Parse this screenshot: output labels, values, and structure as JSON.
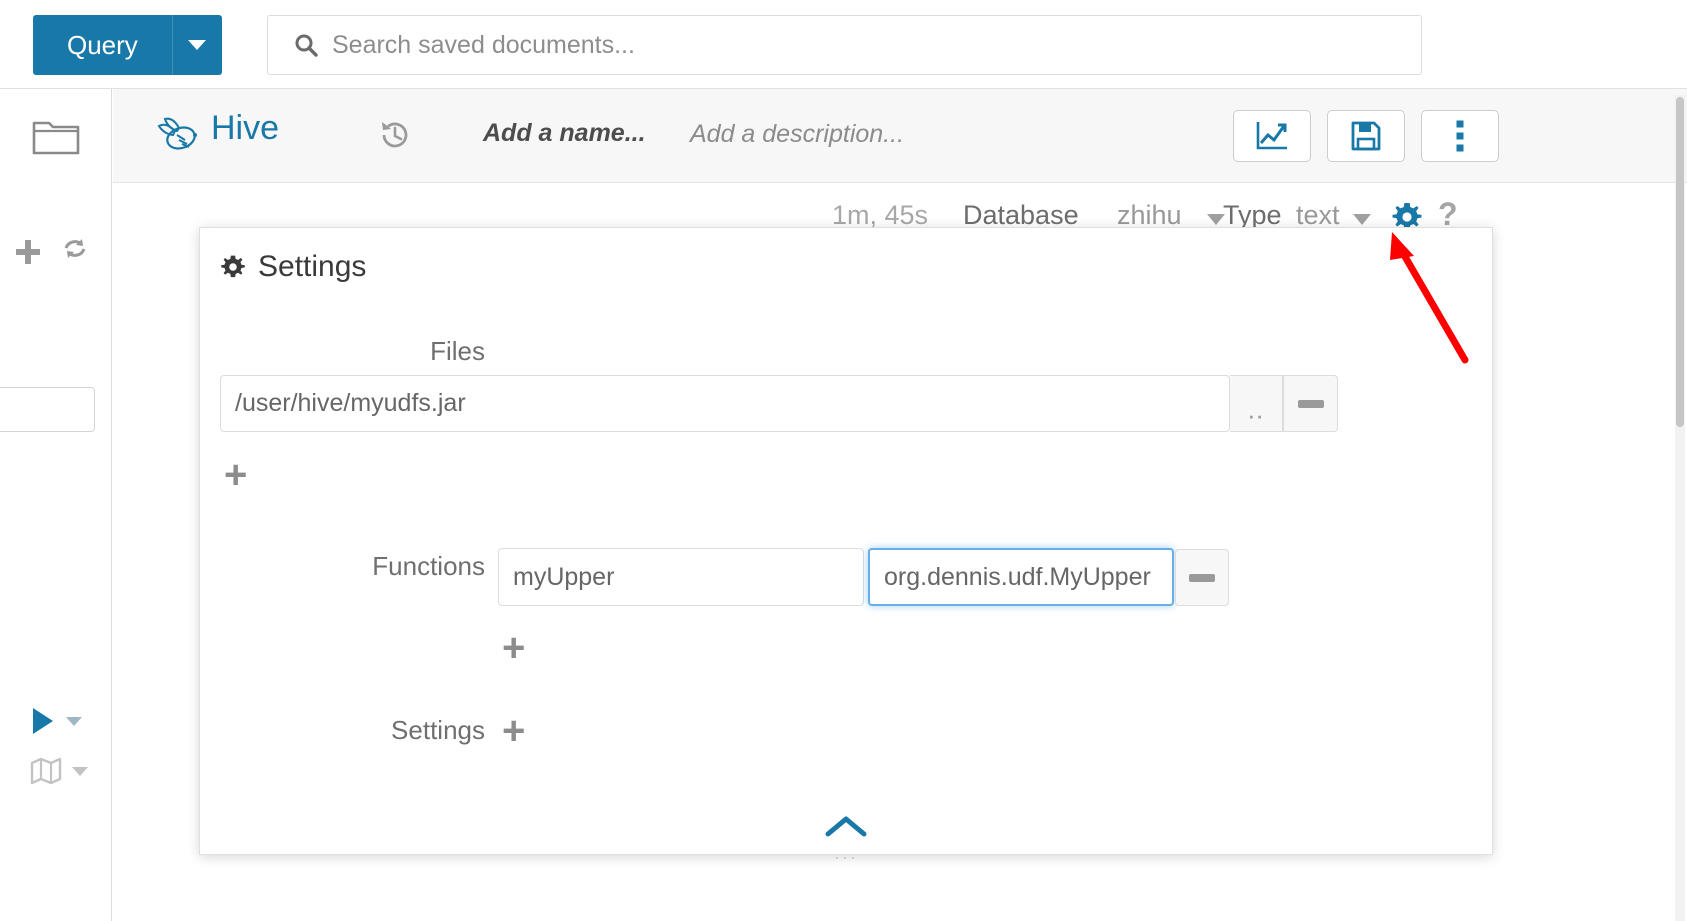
{
  "topbar": {
    "query_button_label": "Query",
    "query_dropdown_icon": "chevron-down-icon",
    "search_icon": "search-icon",
    "search_placeholder": "Search saved documents...",
    "search_value": ""
  },
  "left_rail": {
    "folder_icon": "folder-icon",
    "assist_paren": ")",
    "add_icon": "plus-icon",
    "refresh_icon": "refresh-icon",
    "run_icon": "play-icon",
    "run_caret_icon": "chevron-down-icon",
    "map_icon": "map-icon",
    "map_caret_icon": "chevron-down-icon"
  },
  "editor_header": {
    "logo_icon": "hive-bee-icon",
    "title": "Hive",
    "history_icon": "history-revert-icon",
    "name_placeholder": "Add a name...",
    "description_placeholder": "Add a description...",
    "buttons": [
      {
        "name": "chart-button",
        "icon": "chart-line-icon"
      },
      {
        "name": "save-button",
        "icon": "floppy-save-icon"
      },
      {
        "name": "more-options-button",
        "icon": "vertical-dots-icon"
      }
    ]
  },
  "sub_toolbar": {
    "elapsed": "1m, 45s",
    "database_label": "Database",
    "database_value": "zhihu",
    "type_label": "Type",
    "type_value": "text",
    "settings_icon": "gear-icon",
    "help_icon": "question-mark-icon"
  },
  "settings_panel": {
    "title": "Settings",
    "title_icon": "gear-icon",
    "files": {
      "label": "Files",
      "value": "/user/hive/myudfs.jar",
      "placeholder": "",
      "browse_label": "..",
      "remove_icon": "minus-icon",
      "add_icon": "plus-icon"
    },
    "functions": {
      "label": "Functions",
      "name_value": "myUpper",
      "name_placeholder": "",
      "class_value": "org.dennis.udf.MyUpper",
      "class_placeholder": "",
      "remove_icon": "minus-icon",
      "add_icon": "plus-icon"
    },
    "settings": {
      "label": "Settings",
      "add_icon": "plus-icon"
    },
    "collapse_icon": "chevron-up-icon",
    "resize_grip": "···"
  },
  "annotation": {
    "arrow_color": "#ff0000",
    "arrow_target": "settings-gear-icon"
  },
  "colors": {
    "brand_blue": "#1878a8",
    "focus_blue": "#66afe9",
    "panel_bg": "#ffffff",
    "header_bg": "#f7f7f7",
    "muted_text": "#999999"
  }
}
